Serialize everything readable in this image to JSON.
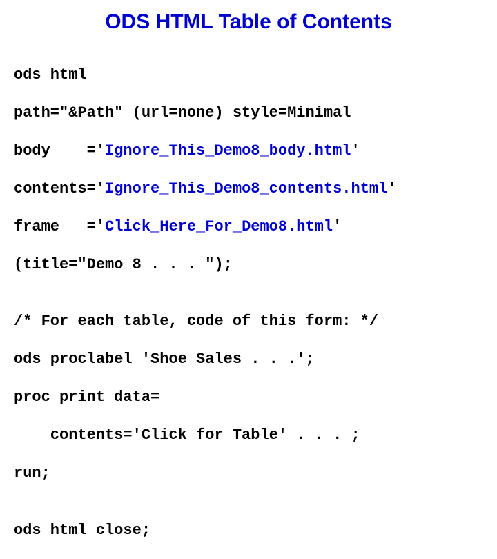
{
  "title": "ODS HTML Table of Contents",
  "code": {
    "line1": "ods html",
    "line2": "path=\"&Path\" (url=none) style=Minimal",
    "line3a": "body    ='",
    "line3b": "Ignore_This_Demo8_body.html",
    "line3c": "'",
    "line4a": "contents='",
    "line4b": "Ignore_This_Demo8_contents.html",
    "line4c": "'",
    "line5a": "frame   ='",
    "line5b": "Click_Here_For_Demo8.html",
    "line5c": "'",
    "line6": "(title=\"Demo 8 . . . \");",
    "line7": "",
    "line8": "/* For each table, code of this form: */",
    "line9": "ods proclabel 'Shoe Sales . . .';",
    "line10": "proc print data=",
    "line11": "    contents='Click for Table' . . . ;",
    "line12": "run;",
    "line13": "",
    "line14": "ods html close;"
  }
}
